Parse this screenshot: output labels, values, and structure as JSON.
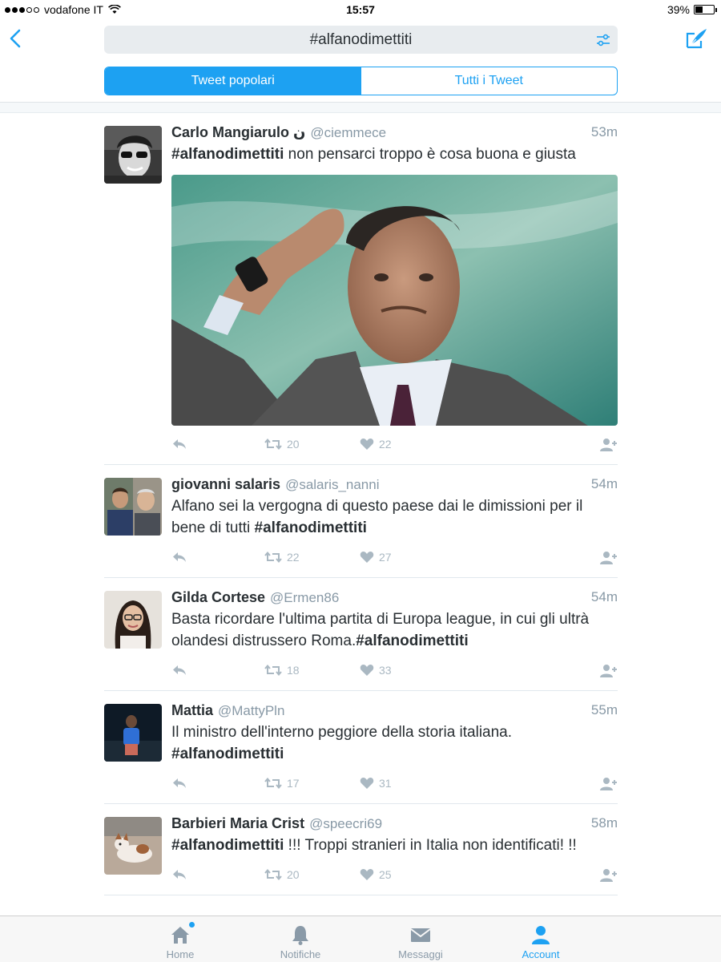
{
  "status_bar": {
    "carrier": "vodafone IT",
    "time": "15:57",
    "battery": "39%",
    "battery_level": 0.39
  },
  "search": {
    "query": "#alfanodimettiti"
  },
  "tabs": [
    {
      "label": "Tweet popolari",
      "active": true
    },
    {
      "label": "Tutti i Tweet",
      "active": false
    }
  ],
  "tweets": [
    {
      "name": "Carlo Mangiarulo ن",
      "handle": "@ciemmece",
      "time": "53m",
      "text_parts": [
        "#alfanodimettiti",
        " non pensarci troppo è cosa buona e giusta"
      ],
      "has_image": true,
      "retweets": "20",
      "likes": "22"
    },
    {
      "name": "giovanni salaris",
      "handle": "@salaris_nanni",
      "time": "54m",
      "text_parts": [
        "Alfano sei la vergogna di questo paese dai le dimissioni per il bene di tutti ",
        "#alfanodimettiti"
      ],
      "retweets": "22",
      "likes": "27"
    },
    {
      "name": "Gilda Cortese",
      "handle": "@Ermen86",
      "time": "54m",
      "text_parts": [
        "Basta ricordare l'ultima partita di Europa league, in cui gli ultrà olandesi distrussero Roma.",
        "#alfanodimettiti"
      ],
      "retweets": "18",
      "likes": "33"
    },
    {
      "name": "Mattia",
      "handle": "@MattyPln",
      "time": "55m",
      "text_parts": [
        "Il ministro dell'interno peggiore della storia italiana. ",
        "#alfanodimettiti"
      ],
      "retweets": "17",
      "likes": "31"
    },
    {
      "name": "Barbieri Maria Crist",
      "handle": "@speecri69",
      "time": "58m",
      "text_parts": [
        "#alfanodimettiti",
        " !!! Troppi stranieri in Italia non identificati! !!"
      ],
      "retweets": "20",
      "likes": "25"
    }
  ],
  "tabbar": [
    {
      "label": "Home",
      "icon": "home-icon",
      "active": false,
      "badge": true
    },
    {
      "label": "Notifiche",
      "icon": "bell-icon",
      "active": false
    },
    {
      "label": "Messaggi",
      "icon": "envelope-icon",
      "active": false
    },
    {
      "label": "Account",
      "icon": "person-icon",
      "active": true
    }
  ],
  "colors": {
    "accent": "#1da1f2",
    "muted": "#8899a6",
    "text": "#292f33"
  }
}
